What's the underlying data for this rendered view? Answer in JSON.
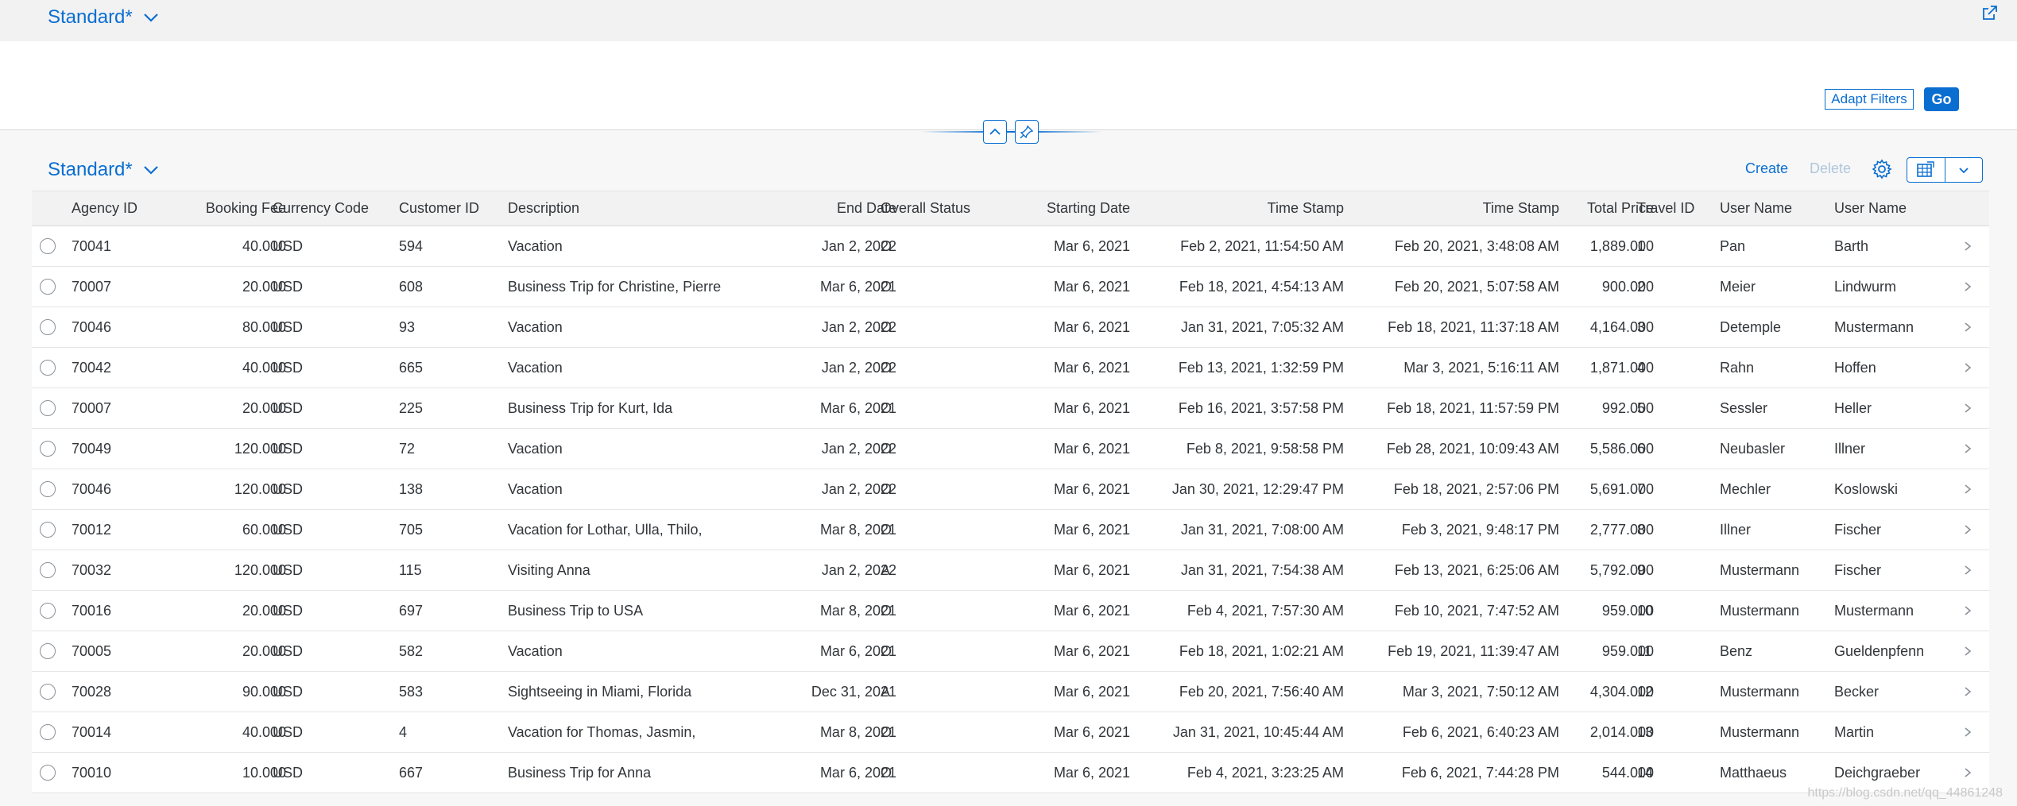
{
  "header": {
    "variant": "Standard*"
  },
  "filterbar": {
    "adapt_label": "Adapt Filters",
    "go_label": "Go"
  },
  "table": {
    "variant": "Standard*",
    "create_label": "Create",
    "delete_label": "Delete",
    "columns": [
      "Agency ID",
      "Booking Fee",
      "Currency Code",
      "Customer ID",
      "Description",
      "End Date",
      "Overall Status",
      "Starting Date",
      "Time Stamp",
      "Time Stamp",
      "Total Price",
      "Travel ID",
      "User Name",
      "User Name"
    ],
    "rows": [
      [
        "70041",
        "40.000",
        "USD",
        "594",
        "Vacation",
        "Jan 2, 2022",
        "O",
        "Mar 6, 2021",
        "Feb 2, 2021, 11:54:50 AM",
        "Feb 20, 2021, 3:48:08 AM",
        "1,889.000",
        "1",
        "Pan",
        "Barth"
      ],
      [
        "70007",
        "20.000",
        "USD",
        "608",
        "Business Trip for Christine, Pierre",
        "Mar 6, 2021",
        "O",
        "Mar 6, 2021",
        "Feb 18, 2021, 4:54:13 AM",
        "Feb 20, 2021, 5:07:58 AM",
        "900.000",
        "2",
        "Meier",
        "Lindwurm"
      ],
      [
        "70046",
        "80.000",
        "USD",
        "93",
        "Vacation",
        "Jan 2, 2022",
        "O",
        "Mar 6, 2021",
        "Jan 31, 2021, 7:05:32 AM",
        "Feb 18, 2021, 11:37:18 AM",
        "4,164.000",
        "3",
        "Detemple",
        "Mustermann"
      ],
      [
        "70042",
        "40.000",
        "USD",
        "665",
        "Vacation",
        "Jan 2, 2022",
        "O",
        "Mar 6, 2021",
        "Feb 13, 2021, 1:32:59 PM",
        "Mar 3, 2021, 5:16:11 AM",
        "1,871.000",
        "4",
        "Rahn",
        "Hoffen"
      ],
      [
        "70007",
        "20.000",
        "USD",
        "225",
        "Business Trip for Kurt, Ida",
        "Mar 6, 2021",
        "O",
        "Mar 6, 2021",
        "Feb 16, 2021, 3:57:58 PM",
        "Feb 18, 2021, 11:57:59 PM",
        "992.000",
        "5",
        "Sessler",
        "Heller"
      ],
      [
        "70049",
        "120.000",
        "USD",
        "72",
        "Vacation",
        "Jan 2, 2022",
        "O",
        "Mar 6, 2021",
        "Feb 8, 2021, 9:58:58 PM",
        "Feb 28, 2021, 10:09:43 AM",
        "5,586.000",
        "6",
        "Neubasler",
        "Illner"
      ],
      [
        "70046",
        "120.000",
        "USD",
        "138",
        "Vacation",
        "Jan 2, 2022",
        "O",
        "Mar 6, 2021",
        "Jan 30, 2021, 12:29:47 PM",
        "Feb 18, 2021, 2:57:06 PM",
        "5,691.000",
        "7",
        "Mechler",
        "Koslowski"
      ],
      [
        "70012",
        "60.000",
        "USD",
        "705",
        "Vacation for Lothar, Ulla, Thilo,",
        "Mar 8, 2021",
        "O",
        "Mar 6, 2021",
        "Jan 31, 2021, 7:08:00 AM",
        "Feb 3, 2021, 9:48:17 PM",
        "2,777.000",
        "8",
        "Illner",
        "Fischer"
      ],
      [
        "70032",
        "120.000",
        "USD",
        "115",
        "Visiting Anna",
        "Jan 2, 2022",
        "A",
        "Mar 6, 2021",
        "Jan 31, 2021, 7:54:38 AM",
        "Feb 13, 2021, 6:25:06 AM",
        "5,792.000",
        "9",
        "Mustermann",
        "Fischer"
      ],
      [
        "70016",
        "20.000",
        "USD",
        "697",
        "Business Trip to USA",
        "Mar 8, 2021",
        "O",
        "Mar 6, 2021",
        "Feb 4, 2021, 7:57:30 AM",
        "Feb 10, 2021, 7:47:52 AM",
        "959.000",
        "10",
        "Mustermann",
        "Mustermann"
      ],
      [
        "70005",
        "20.000",
        "USD",
        "582",
        "Vacation",
        "Mar 6, 2021",
        "O",
        "Mar 6, 2021",
        "Feb 18, 2021, 1:02:21 AM",
        "Feb 19, 2021, 11:39:47 AM",
        "959.000",
        "11",
        "Benz",
        "Gueldenpfenn"
      ],
      [
        "70028",
        "90.000",
        "USD",
        "583",
        "Sightseeing in Miami, Florida",
        "Dec 31, 2021",
        "A",
        "Mar 6, 2021",
        "Feb 20, 2021, 7:56:40 AM",
        "Mar 3, 2021, 7:50:12 AM",
        "4,304.000",
        "12",
        "Mustermann",
        "Becker"
      ],
      [
        "70014",
        "40.000",
        "USD",
        "4",
        "Vacation for Thomas, Jasmin,",
        "Mar 8, 2021",
        "O",
        "Mar 6, 2021",
        "Jan 31, 2021, 10:45:44 AM",
        "Feb 6, 2021, 6:40:23 AM",
        "2,014.000",
        "13",
        "Mustermann",
        "Martin"
      ],
      [
        "70010",
        "10.000",
        "USD",
        "667",
        "Business Trip for Anna",
        "Mar 6, 2021",
        "O",
        "Mar 6, 2021",
        "Feb 4, 2021, 3:23:25 AM",
        "Feb 6, 2021, 7:44:28 PM",
        "544.000",
        "14",
        "Matthaeus",
        "Deichgraeber"
      ]
    ]
  },
  "watermark": "https://blog.csdn.net/qq_44861248",
  "icons": {
    "share": "share-icon",
    "chevron": "chevron-down-icon",
    "collapse": "chevron-up-icon",
    "pin": "pin-icon",
    "settings": "gear-icon",
    "export": "spreadsheet-icon",
    "nav": "chevron-right-icon"
  },
  "colors": {
    "accent": "#0a6ed1",
    "text": "#32363a",
    "header_bg": "#f2f2f2"
  }
}
